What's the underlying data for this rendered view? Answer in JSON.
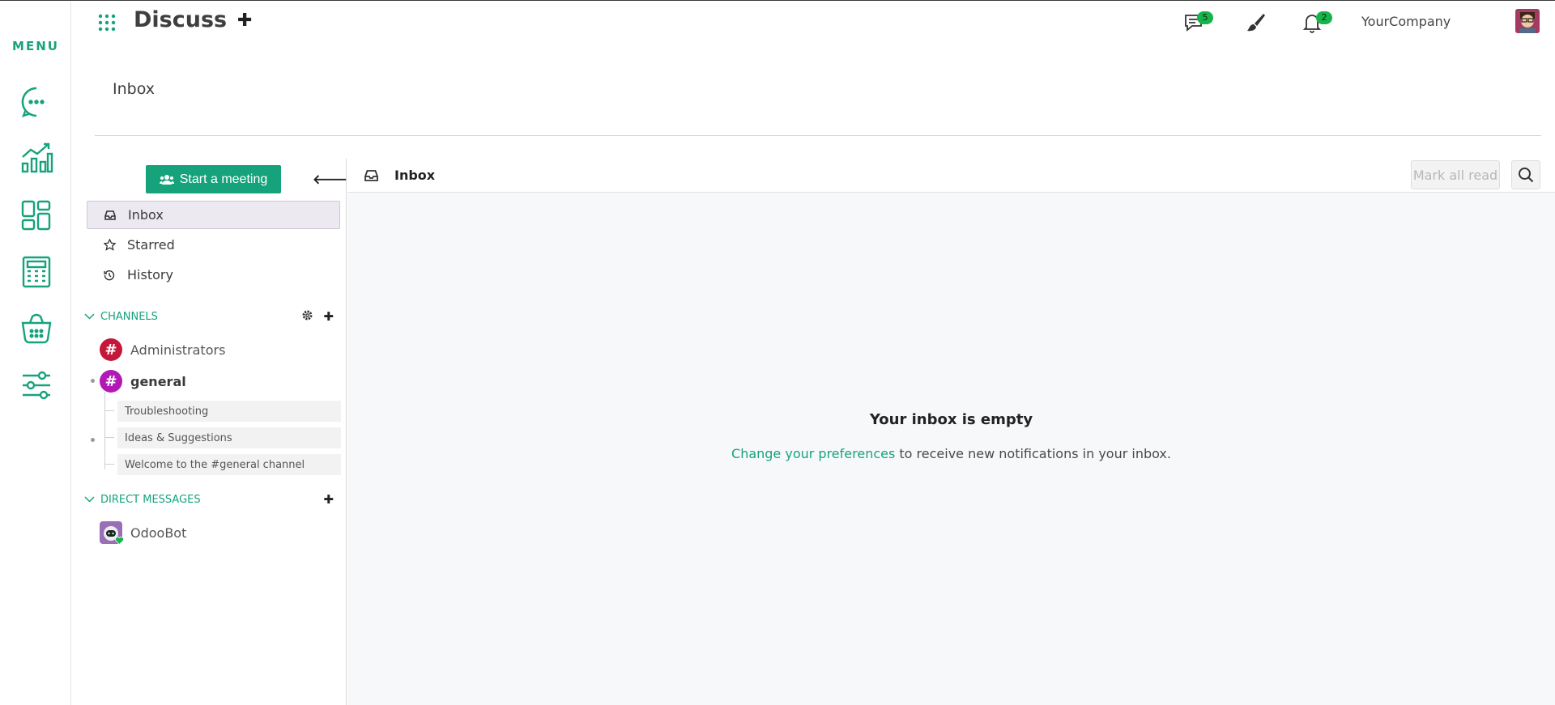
{
  "rail": {
    "title": "MENU",
    "icons": [
      "chat-icon",
      "chart-icon",
      "dashboard-icon",
      "calculator-icon",
      "basket-icon",
      "settings-sliders-icon"
    ]
  },
  "topbar": {
    "app_title": "Discuss",
    "messages_badge": "5",
    "activity_badge": "2",
    "company": "YourCompany"
  },
  "breadcrumb": "Inbox",
  "sidebar": {
    "meeting_button": "Start a meeting",
    "nav": [
      {
        "label": "Inbox",
        "icon": "inbox-icon",
        "active": true
      },
      {
        "label": "Starred",
        "icon": "star-icon",
        "active": false
      },
      {
        "label": "History",
        "icon": "history-icon",
        "active": false
      }
    ],
    "channels_header": "CHANNELS",
    "channels": [
      {
        "name": "Administrators",
        "color": "#c5173a",
        "bold": false
      },
      {
        "name": "general",
        "color": "#b218b5",
        "bold": true
      }
    ],
    "threads": [
      "Troubleshooting",
      "Ideas & Suggestions",
      "Welcome to the #general channel"
    ],
    "dm_header": "DIRECT MESSAGES",
    "dms": [
      {
        "name": "OdooBot"
      }
    ]
  },
  "main": {
    "title": "Inbox",
    "mark_all_read": "Mark all read",
    "empty_title": "Your inbox is empty",
    "empty_link": "Change your preferences",
    "empty_rest": " to receive new notifications in your inbox."
  },
  "colors": {
    "accent": "#16a37b",
    "badge": "#18b34a"
  }
}
